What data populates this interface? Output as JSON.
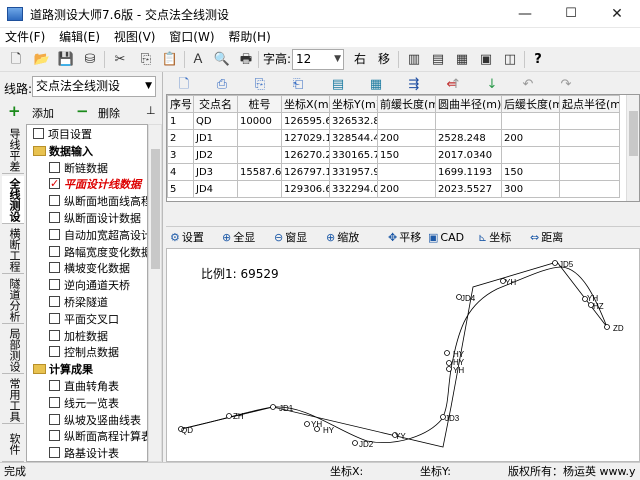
{
  "window": {
    "title": "道路测设大师7.6版 - 交点法全线测设",
    "min": "—",
    "max": "☐",
    "close": "✕"
  },
  "menu": [
    "文件(F)",
    "编辑(E)",
    "视图(V)",
    "窗口(W)",
    "帮助(H)"
  ],
  "toolbar": {
    "font_height_label": "字高:",
    "font_height_value": "12",
    "right_label": "右",
    "move_label": "移"
  },
  "left": {
    "line_label": "线路:",
    "line_value": "交点法全线测设",
    "add_label": "添加",
    "delete_label": "删除",
    "vertical_tabs": [
      "导线平差",
      "全线测设",
      "横断工程",
      "隧道分析",
      "局部测设",
      "常用工具",
      "软件"
    ],
    "tree": [
      {
        "kind": "cb",
        "level": 0,
        "label": "项目设置"
      },
      {
        "kind": "folder",
        "level": 0,
        "label": "数据输入",
        "bold": true
      },
      {
        "kind": "cb",
        "level": 1,
        "label": "断链数据"
      },
      {
        "kind": "cb-checked",
        "level": 1,
        "label": "平面设计线数据",
        "red": true
      },
      {
        "kind": "cb",
        "level": 1,
        "label": "纵断面地面线高程"
      },
      {
        "kind": "cb",
        "level": 1,
        "label": "纵断面设计数据"
      },
      {
        "kind": "cb",
        "level": 1,
        "label": "自动加宽超高设计"
      },
      {
        "kind": "cb",
        "level": 1,
        "label": "路幅宽度变化数据"
      },
      {
        "kind": "cb",
        "level": 1,
        "label": "横坡变化数据"
      },
      {
        "kind": "cb",
        "level": 1,
        "label": "逆向通道天桥"
      },
      {
        "kind": "cb",
        "level": 1,
        "label": "桥梁隧道"
      },
      {
        "kind": "cb",
        "level": 1,
        "label": "平面交叉口"
      },
      {
        "kind": "cb",
        "level": 1,
        "label": "加桩数据"
      },
      {
        "kind": "cb",
        "level": 1,
        "label": "控制点数据"
      },
      {
        "kind": "folder",
        "level": 0,
        "label": "计算成果",
        "bold": true
      },
      {
        "kind": "cb",
        "level": 1,
        "label": "直曲转角表"
      },
      {
        "kind": "cb",
        "level": 1,
        "label": "线元一览表"
      },
      {
        "kind": "cb",
        "level": 1,
        "label": "纵坡及竖曲线表"
      },
      {
        "kind": "cb",
        "level": 1,
        "label": "纵断面高程计算表"
      },
      {
        "kind": "cb",
        "level": 1,
        "label": "路基设计表"
      }
    ]
  },
  "grid": {
    "columns": [
      "序号",
      "交点名",
      "桩号",
      "坐标X(m)",
      "坐标Y(m)",
      "前缓长度(m)",
      "圆曲半径(m)",
      "后缓长度(m)",
      "起点半径(m)"
    ],
    "rows": [
      [
        "1",
        "QD",
        "10000",
        "126595.6",
        "326532.86",
        "",
        "",
        "",
        ""
      ],
      [
        "2",
        "JD1",
        "",
        "127029.19",
        "328544.44",
        "200",
        "2528.248",
        "200",
        ""
      ],
      [
        "3",
        "JD2",
        "",
        "126270.2",
        "330165.76",
        "150",
        "2017.0340",
        "",
        ""
      ],
      [
        "4",
        "JD3",
        "15587.65",
        "126797.1",
        "331957.95",
        "",
        "1699.1193",
        "150",
        ""
      ],
      [
        "5",
        "JD4",
        "",
        "129306.6",
        "332294.0",
        "200",
        "2023.5527",
        "300",
        ""
      ]
    ]
  },
  "plot_toolbar": [
    {
      "icon": "settings-icon",
      "glyph": "⚙",
      "label": "设置"
    },
    {
      "icon": "zoom-all-icon",
      "glyph": "⊕",
      "label": "全显"
    },
    {
      "icon": "zoom-window-icon",
      "glyph": "⊖",
      "label": "窗显"
    },
    {
      "icon": "zoom-icon",
      "glyph": "⊕",
      "label": "缩放"
    },
    {
      "icon": "pan-icon",
      "glyph": "✥",
      "label": "平移"
    },
    {
      "icon": "cad-icon",
      "glyph": "▣",
      "label": "CAD"
    },
    {
      "icon": "coordinate-icon",
      "glyph": "⊾",
      "label": "坐标"
    },
    {
      "icon": "distance-icon",
      "glyph": "⇔",
      "label": "距离"
    }
  ],
  "plot": {
    "scale_text": "比例1:  69529",
    "labels": [
      "QD",
      "ZH",
      "JD1",
      "YH",
      "HY",
      "JD2",
      "YY",
      "JD3",
      "HY",
      "HY",
      "YH",
      "JD4",
      "YH",
      "JD5",
      "YH",
      "HZ",
      "ZD"
    ]
  },
  "status": {
    "ready": "完成",
    "x_label": "坐标X:",
    "y_label": "坐标Y:",
    "copyright": "版权所有：杨运英  www.y"
  }
}
